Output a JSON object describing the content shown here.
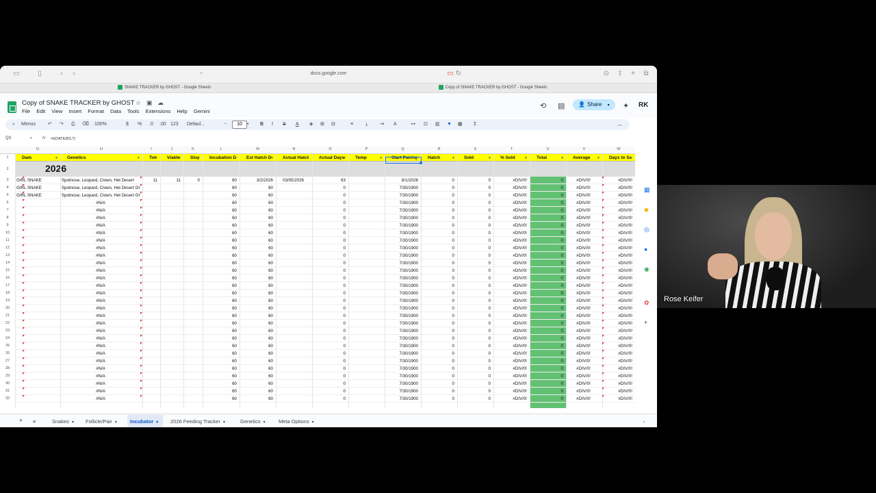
{
  "browser": {
    "url": "docs.google.com",
    "tabs": [
      "SNAKE TRACKER by GHOST - Google Sheets",
      "Copy of SNAKE TRACKER by GHOST - Google Sheets"
    ]
  },
  "sheets": {
    "title": "Copy of SNAKE TRACKER by GHOST",
    "menu": [
      "File",
      "Edit",
      "View",
      "Insert",
      "Format",
      "Data",
      "Tools",
      "Extensions",
      "Help",
      "Gemini"
    ],
    "share_label": "Share",
    "account_initials": "RK"
  },
  "toolbar": {
    "menus_label": "Menus",
    "zoom": "100%",
    "currency": "$",
    "percent": "%",
    "dec_dec": ".0",
    "dec_inc": ".00",
    "number_format": "123",
    "font": "Defaul...",
    "font_size": "10"
  },
  "formula_bar": {
    "cell_ref": "Q3",
    "fx": "fx",
    "formula": "=EDATE(B3,7)"
  },
  "columns": [
    "G",
    "H",
    "I",
    "J",
    "K",
    "L",
    "M",
    "N",
    "O",
    "P",
    "Q",
    "R",
    "S",
    "T",
    "U",
    "V",
    "W"
  ],
  "header_row": [
    "Dam",
    "Genetics",
    "Tota",
    "Viable",
    "Slugs",
    "Incubation D",
    "Est Hatch D",
    "Actual Hatch",
    "Actual Days",
    "Temp",
    "Start Pairing",
    "Hatch",
    "Sold",
    "% Sold",
    "Total",
    "Average",
    "Days to Sale"
  ],
  "year_label": "2026",
  "data_rows": [
    {
      "num": "3",
      "dam": "GIRL SNAKE",
      "genetics": "Spotnose, Leopard, Clown, Het Desert",
      "total": "11",
      "viable": "11",
      "slugs": "0",
      "incubation": "60",
      "est_hatch": "3/2/2026",
      "actual_hatch": "03/05/2026",
      "actual_days": "63",
      "start_pairing": "8/1/2026",
      "hatch": "0",
      "sold": "0",
      "pct_sold": "#DIV/0!",
      "total2": "0",
      "average": "#DIV/0!",
      "days_to_sale": "#DIV/0!"
    },
    {
      "num": "4",
      "dam": "GIRL SNAKE",
      "genetics": "Spotnose, Leopard, Clown, Het Desert Ghost",
      "incubation": "60",
      "est_hatch": "60",
      "actual_days": "0",
      "start_pairing": "7/30/1900",
      "hatch": "0",
      "sold": "0",
      "pct_sold": "#DIV/0!",
      "total2": "0",
      "average": "#DIV/0!",
      "days_to_sale": "#DIV/0!"
    },
    {
      "num": "5",
      "dam": "GIRL SNAKE",
      "genetics": "Spotnose, Leopard, Clown, Het Desert Ghost",
      "incubation": "60",
      "est_hatch": "60",
      "actual_days": "0",
      "start_pairing": "7/30/1900",
      "hatch": "0",
      "sold": "0",
      "pct_sold": "#DIV/0!",
      "total2": "0",
      "average": "#DIV/0!",
      "days_to_sale": "#DIV/0!"
    }
  ],
  "filler_row": {
    "genetics": "#N/A",
    "incubation": "60",
    "est_hatch": "60",
    "actual_days": "0",
    "start_pairing": "7/30/1900",
    "hatch": "0",
    "sold": "0",
    "pct_sold": "#DIV/0!",
    "total2": "0",
    "average": "#DIV/0!",
    "days_to_sale": "#DIV/0!"
  },
  "row_numbers": [
    "1",
    "2",
    "3",
    "4",
    "5",
    "6",
    "7",
    "8",
    "9",
    "10",
    "11",
    "12",
    "13",
    "14",
    "15",
    "16",
    "17",
    "18",
    "19",
    "20",
    "21",
    "22",
    "23",
    "24",
    "25",
    "26",
    "27",
    "28",
    "29",
    "30",
    "31",
    "32"
  ],
  "sheet_tabs": [
    "Snakes",
    "Follicle/Pair",
    "Incubator",
    "2026 Feeding Tracker",
    "Genetics",
    "Meta Options"
  ],
  "active_tab": "Incubator",
  "webcam": {
    "name": "Rose Keifer"
  },
  "colors": {
    "header_yellow": "#ffff00",
    "total_green": "#63c174",
    "share_bg": "#c2e7ff",
    "selection": "#1a73e8"
  }
}
